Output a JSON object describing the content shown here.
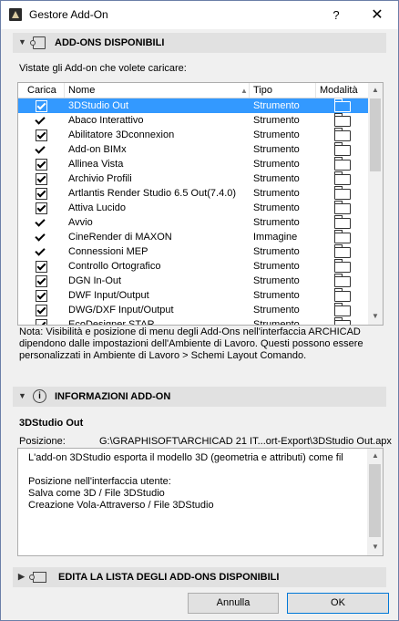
{
  "window": {
    "title": "Gestore Add-On",
    "help": "?",
    "close": "✕"
  },
  "available": {
    "header": "ADD-ONS DISPONIBILI",
    "subtitle": "Vistate gli Add-on che volete caricare:"
  },
  "table": {
    "columns": [
      "Carica",
      "Nome",
      "Tipo",
      "Modalità"
    ],
    "rows": [
      {
        "name": "3DStudio Out",
        "type": "Strumento",
        "check": "box",
        "selected": true
      },
      {
        "name": "Abaco Interattivo",
        "type": "Strumento",
        "check": "tick",
        "selected": false
      },
      {
        "name": "Abilitatore 3Dconnexion",
        "type": "Strumento",
        "check": "box",
        "selected": false
      },
      {
        "name": "Add-on BIMx",
        "type": "Strumento",
        "check": "tick",
        "selected": false
      },
      {
        "name": "Allinea Vista",
        "type": "Strumento",
        "check": "box",
        "selected": false
      },
      {
        "name": "Archivio Profili",
        "type": "Strumento",
        "check": "box",
        "selected": false
      },
      {
        "name": "Artlantis Render Studio 6.5 Out(7.4.0)",
        "type": "Strumento",
        "check": "box",
        "selected": false
      },
      {
        "name": "Attiva Lucido",
        "type": "Strumento",
        "check": "box",
        "selected": false
      },
      {
        "name": "Avvio",
        "type": "Strumento",
        "check": "tick",
        "selected": false
      },
      {
        "name": "CineRender di MAXON",
        "type": "Immagine",
        "check": "tick",
        "selected": false
      },
      {
        "name": "Connessioni MEP",
        "type": "Strumento",
        "check": "tick",
        "selected": false
      },
      {
        "name": "Controllo Ortografico",
        "type": "Strumento",
        "check": "box",
        "selected": false
      },
      {
        "name": "DGN In-Out",
        "type": "Strumento",
        "check": "box",
        "selected": false
      },
      {
        "name": "DWF Input/Output",
        "type": "Strumento",
        "check": "box",
        "selected": false
      },
      {
        "name": "DWG/DXF Input/Output",
        "type": "Strumento",
        "check": "box",
        "selected": false
      },
      {
        "name": "EcoDesigner STAR",
        "type": "Strumento",
        "check": "box",
        "selected": false
      }
    ]
  },
  "note": "Nota: Visibilità e posizione di menu degli Add-Ons nell'interfaccia ARCHICAD dipendono dalle impostazioni dell'Ambiente di Lavoro. Questi possono essere personalizzati in Ambiente di Lavoro > Schemi Layout Comando.",
  "info": {
    "header": "INFORMAZIONI ADD-ON",
    "addon_name": "3DStudio Out",
    "position_label": "Posizione:",
    "position_value": "G:\\GRAPHISOFT\\ARCHICAD 21 IT...ort-Export\\3DStudio Out.apx",
    "description": "L'add-on 3DStudio esporta il modello 3D (geometria e attributi) come fil\n\nPosizione nell'interfaccia utente:\nSalva come 3D / File 3DStudio\nCreazione Vola-Attraverso / File 3DStudio"
  },
  "edit_section": {
    "header": "EDITA LA LISTA DEGLI ADD-ONS DISPONIBILI"
  },
  "buttons": {
    "cancel": "Annulla",
    "ok": "OK"
  }
}
